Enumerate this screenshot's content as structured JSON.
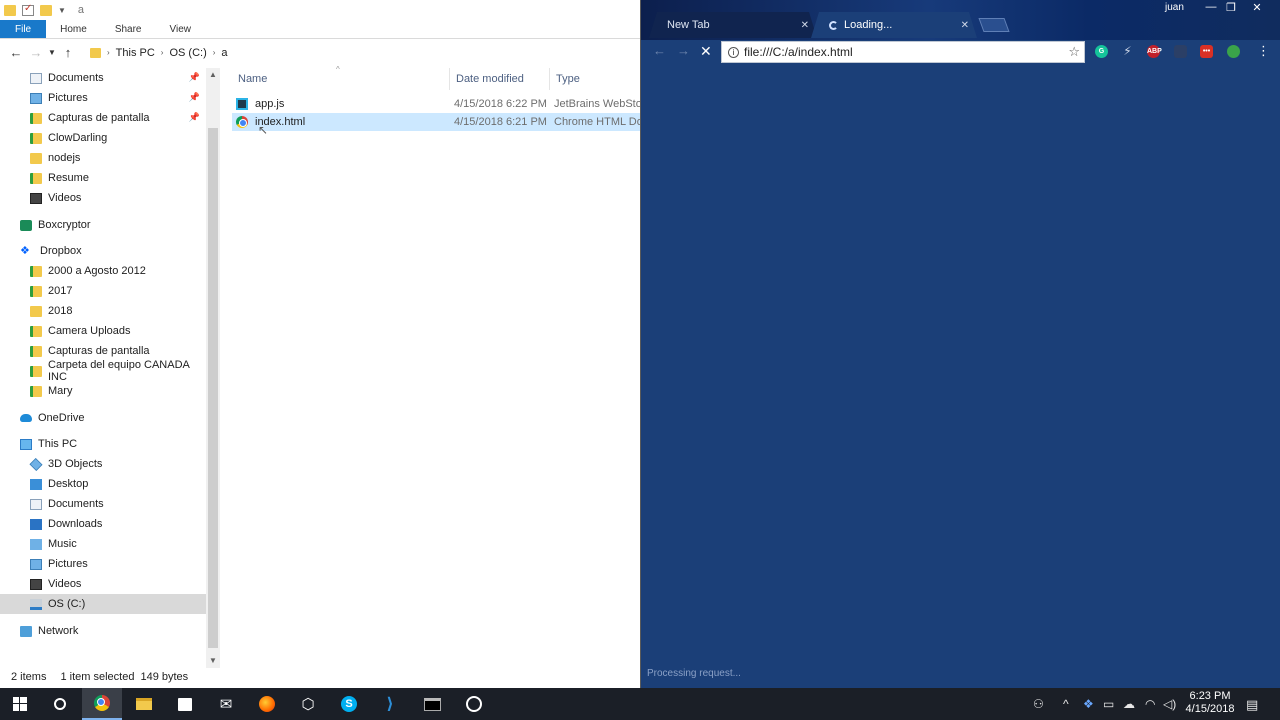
{
  "explorer": {
    "title": "a",
    "ribbon": {
      "file": "File",
      "home": "Home",
      "share": "Share",
      "view": "View"
    },
    "breadcrumb": {
      "this_pc": "This PC",
      "drive": "OS (C:)",
      "folder": "a"
    },
    "nav": {
      "documents_quick": "Documents",
      "pictures_quick": "Pictures",
      "capturas_quick": "Capturas de pantalla",
      "clowdarling": "ClowDarling",
      "nodejs": "nodejs",
      "resume": "Resume",
      "videos_quick": "Videos",
      "boxcryptor": "Boxcryptor",
      "dropbox": "Dropbox",
      "agosto": "2000 a Agosto 2012",
      "y2017": "2017",
      "y2018": "2018",
      "camera_uploads": "Camera Uploads",
      "capturas_dropbox": "Capturas de pantalla",
      "carpeta_canada": "Carpeta del equipo CANADA INC",
      "mary": "Mary",
      "onedrive": "OneDrive",
      "this_pc": "This PC",
      "objects3d": "3D Objects",
      "desktop": "Desktop",
      "documents": "Documents",
      "downloads": "Downloads",
      "music": "Music",
      "pictures": "Pictures",
      "videos": "Videos",
      "os_c": "OS (C:)",
      "network": "Network"
    },
    "columns": {
      "name": "Name",
      "date": "Date modified",
      "type": "Type"
    },
    "files": [
      {
        "name": "app.js",
        "date": "4/15/2018 6:22 PM",
        "type": "JetBrains WebStorm"
      },
      {
        "name": "index.html",
        "date": "4/15/2018 6:21 PM",
        "type": "Chrome HTML Do..."
      }
    ],
    "status": {
      "items": "2 items",
      "selected": "1 item selected",
      "size": "149 bytes"
    }
  },
  "chrome": {
    "tabs": [
      {
        "label": "New Tab"
      },
      {
        "label": "Loading..."
      }
    ],
    "profile": "juan",
    "url": "file:///C:/a/index.html",
    "extensions": {
      "abp": "ABP"
    },
    "status": "Processing request..."
  },
  "taskbar": {
    "time": "6:23 PM",
    "date": "4/15/2018"
  },
  "colors": {
    "chrome_bg": "#1b3f78",
    "selection": "#cce8ff",
    "ribbon_file": "#1979ca",
    "taskbar": "#1b1f27"
  }
}
